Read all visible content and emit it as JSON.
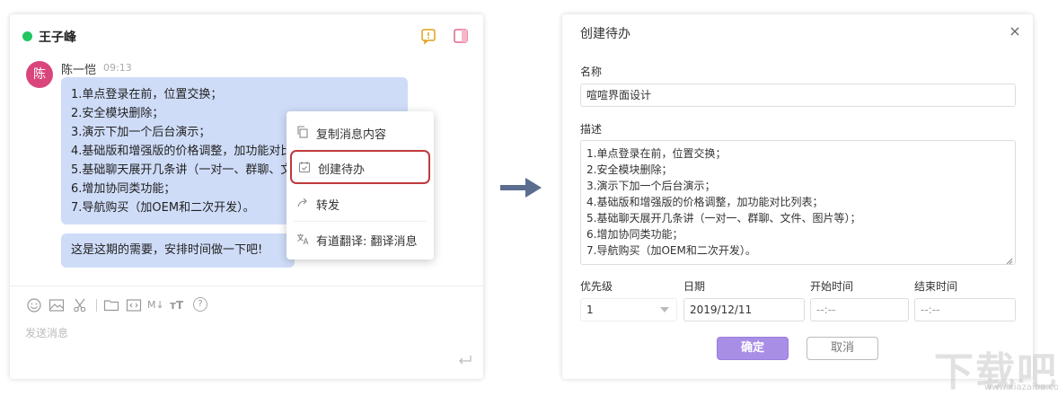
{
  "chat": {
    "contact_name": "王子峰",
    "status_color": "#22c55e",
    "header_icons": [
      "todo-icon",
      "sidebar-toggle-icon"
    ],
    "message": {
      "avatar_text": "陈",
      "avatar_color": "#d9467c",
      "sender": "陈一恺",
      "time": "09:13",
      "lines": [
        "1.单点登录在前，位置交换；",
        "2.安全模块删除；",
        "3.演示下加一个后台演示；",
        "4.基础版和增强版的价格调整，加功能对比列表；",
        "5.基础聊天展开几条讲（一对一、群聊、文件、图片等）；",
        "6.增加协同类功能；",
        "7.导航购买（加OEM和二次开发）。"
      ],
      "followup": "这是这期的需要，安排时间做一下吧!"
    },
    "context_menu": [
      {
        "label": "复制消息内容",
        "icon": "copy-icon"
      },
      {
        "label": "创建待办",
        "icon": "calendar-check-icon",
        "highlighted": true
      },
      {
        "label": "转发",
        "icon": "forward-icon"
      },
      {
        "label": "有道翻译: 翻译消息",
        "icon": "translate-icon"
      }
    ],
    "toolbar_icons": [
      "emoji-icon",
      "image-icon",
      "scissors-icon",
      "folder-icon",
      "code-icon",
      "markdown-icon",
      "text-format-icon",
      "help-icon"
    ],
    "markdown_glyph": "M↓",
    "text_format_glyph": "ᴛT",
    "help_glyph": "?",
    "compose_placeholder": "发送消息",
    "enter_icon": "enter-icon"
  },
  "dialog": {
    "title": "创建待办",
    "close_glyph": "×",
    "name_label": "名称",
    "name_value": "喧喧界面设计",
    "desc_label": "描述",
    "desc_lines": [
      "1.单点登录在前，位置交换；",
      "2.安全模块删除；",
      "3.演示下加一个后台演示；",
      "4.基础版和增强版的价格调整，加功能对比列表；",
      "5.基础聊天展开几条讲（一对一、群聊、文件、图片等）；",
      "6.增加协同类功能；",
      "7.导航购买（加OEM和二次开发）。"
    ],
    "priority_label": "优先级",
    "priority_value": "1",
    "date_label": "日期",
    "date_value": "2019/12/11",
    "start_label": "开始时间",
    "start_value": "--:--",
    "end_label": "结束时间",
    "end_value": "--:--",
    "confirm_label": "确定",
    "cancel_label": "取消",
    "accent_color": "#a98ee6"
  },
  "watermark": {
    "text": "下载吧",
    "url": "www.xiazaiba.com"
  }
}
